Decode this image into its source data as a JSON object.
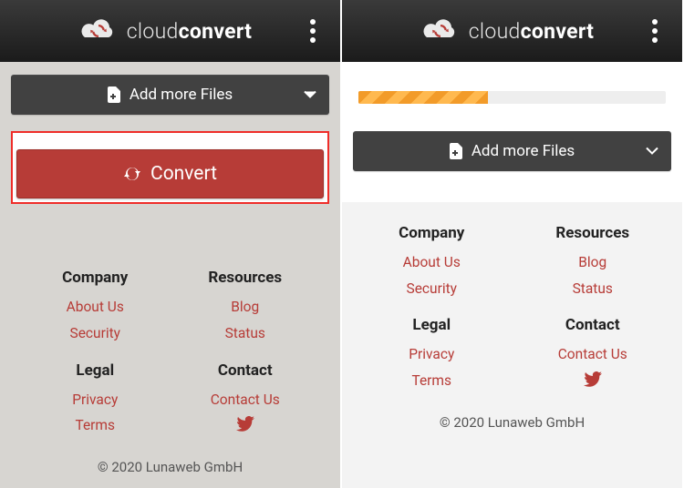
{
  "brand": {
    "light": "cloud",
    "bold": "convert"
  },
  "screenA": {
    "add_files_label": "Add more Files",
    "convert_label": "Convert",
    "footer": {
      "col1": {
        "heading": "Company",
        "links": [
          "About Us",
          "Security"
        ]
      },
      "col2": {
        "heading": "Resources",
        "links": [
          "Blog",
          "Status"
        ]
      },
      "col3": {
        "heading": "Legal",
        "links": [
          "Privacy",
          "Terms"
        ]
      },
      "col4": {
        "heading": "Contact",
        "links": [
          "Contact Us"
        ]
      },
      "copyright": "© 2020 Lunaweb GmbH"
    }
  },
  "screenB": {
    "progress_percent": 42,
    "add_files_label": "Add more Files",
    "footer": {
      "col1": {
        "heading": "Company",
        "links": [
          "About Us",
          "Security"
        ]
      },
      "col2": {
        "heading": "Resources",
        "links": [
          "Blog",
          "Status"
        ]
      },
      "col3": {
        "heading": "Legal",
        "links": [
          "Privacy",
          "Terms"
        ]
      },
      "col4": {
        "heading": "Contact",
        "links": [
          "Contact Us"
        ]
      },
      "copyright": "© 2020 Lunaweb GmbH"
    }
  }
}
